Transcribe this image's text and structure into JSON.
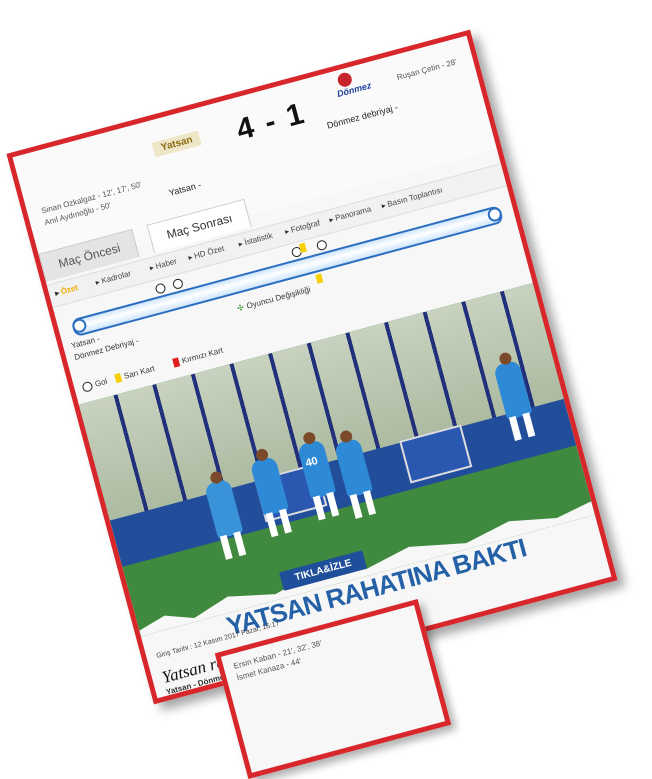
{
  "match": {
    "home_team": "Yatsan",
    "away_team": "Dönmez",
    "score": "4 - 1",
    "home_scorers": [
      "Sinan Ozkalgaz - 12', 17', 50'",
      "Anıl Aydınoğlu - 50'"
    ],
    "away_scorer": "Ruşan Çetin - 28'",
    "home_label": "Yatsan -",
    "away_label": "Dönmez debriyaj -"
  },
  "tabs": [
    "Maç Öncesi",
    "Maç Sonrası"
  ],
  "nav": {
    "items": [
      "Özet",
      "Kadrolar",
      "Haber",
      "HD Özet",
      "İstatistik",
      "Fotoğraf",
      "Panorama",
      "Basın Toplantısı"
    ],
    "highlight_index": 0
  },
  "timeline": {
    "home_label": "Yatsan -",
    "away_label": "Dönmez Debriyaj -",
    "substitution_legend": "Oyuncu Değişikliği",
    "goal_minutes_pct": [
      20,
      24,
      52,
      58
    ],
    "yellow_card_pct": [
      54,
      56
    ]
  },
  "legend": {
    "goal": "Gol",
    "yellow": "Sarı Kart",
    "red": "Kırmızı Kart"
  },
  "article": {
    "tag": "TIKLA&İZLE",
    "headline": "YATSAN RAHATINA BAKTI",
    "date": "Giriş Tarihi : 12 Kasım 2017 Pazar, 16:17",
    "title": "Yatsan rahatına baktı!",
    "author_line": "Yatsan - Dönmez debriyaj -"
  },
  "photo": {
    "player_number": "40"
  },
  "second_card": {
    "lines": [
      "Ersin Kaban - 21', 32', 38'",
      "İsmet Kanaza - 44'"
    ]
  },
  "colors": {
    "frame": "#d8272b",
    "blue": "#2461a6",
    "yellow": "#f6d000"
  }
}
